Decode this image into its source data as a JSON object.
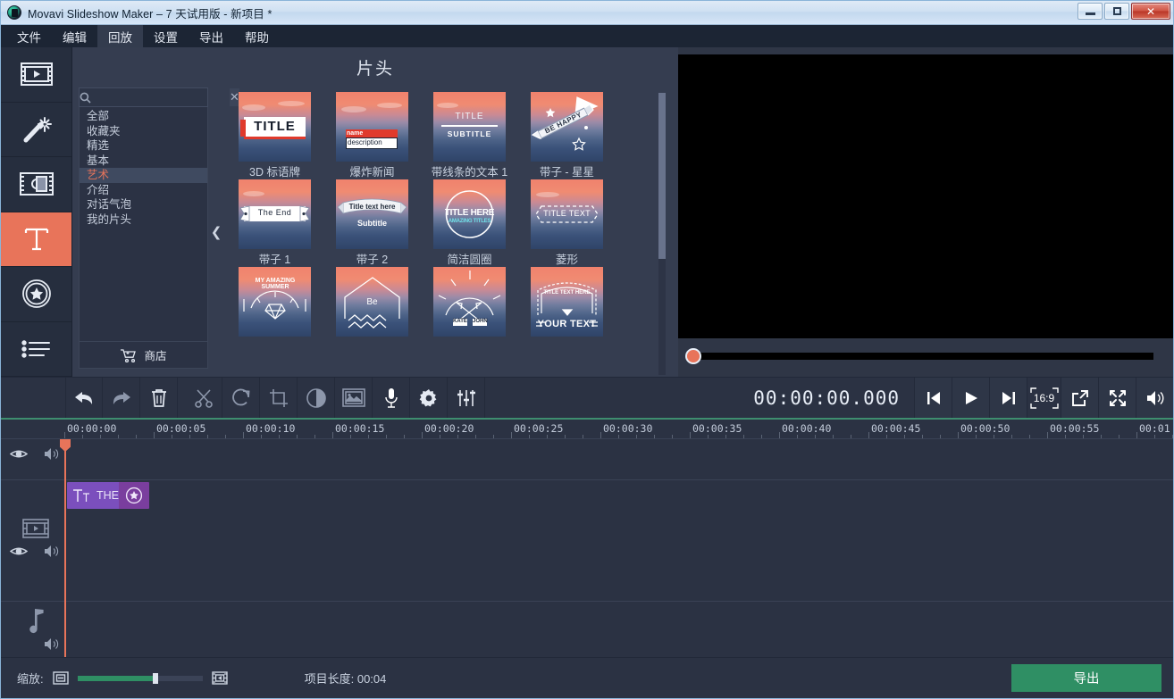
{
  "window": {
    "title": "Movavi Slideshow Maker – 7 天试用版 - 新项目 *",
    "app_icon": "movavi-logo-icon",
    "minimize_label": "",
    "maximize_label": "",
    "close_label": "✕"
  },
  "menubar": {
    "items": [
      {
        "label": "文件",
        "name": "menu-file"
      },
      {
        "label": "编辑",
        "name": "menu-edit"
      },
      {
        "label": "回放",
        "name": "menu-playback",
        "highlighted": true
      },
      {
        "label": "设置",
        "name": "menu-settings"
      },
      {
        "label": "导出",
        "name": "menu-export"
      },
      {
        "label": "帮助",
        "name": "menu-help"
      }
    ]
  },
  "sidebar": {
    "items": [
      {
        "name": "sidebar-item-import",
        "icon": "film-play-icon",
        "active": false
      },
      {
        "name": "sidebar-item-filters",
        "icon": "magic-wand-icon",
        "active": false
      },
      {
        "name": "sidebar-item-transitions",
        "icon": "transition-icon",
        "active": false
      },
      {
        "name": "sidebar-item-titles",
        "icon": "text-t-icon",
        "active": true
      },
      {
        "name": "sidebar-item-stickers",
        "icon": "sticker-star-icon",
        "active": false
      },
      {
        "name": "sidebar-item-more",
        "icon": "list-icon",
        "active": false
      }
    ]
  },
  "library": {
    "header": "片头",
    "search": {
      "value": "",
      "placeholder": "",
      "clear_label": "✕"
    },
    "categories": [
      {
        "label": "全部",
        "selected": false
      },
      {
        "label": "收藏夹",
        "selected": false
      },
      {
        "label": "精选",
        "selected": false
      },
      {
        "label": "基本",
        "selected": false
      },
      {
        "label": "艺术",
        "selected": true
      },
      {
        "label": "介绍",
        "selected": false
      },
      {
        "label": "对话气泡",
        "selected": false
      },
      {
        "label": "我的片头",
        "selected": false
      }
    ],
    "store_label": "商店",
    "collapse_label": "❮",
    "titles": [
      {
        "label": "3D 标语牌",
        "preview_text": "TITLE",
        "style": "board"
      },
      {
        "label": "爆炸新闻",
        "preview_text": "name\ndescription",
        "style": "breaking"
      },
      {
        "label": "带线条的文本 1",
        "preview_text": "TITLE / SUBTITLE",
        "style": "lines"
      },
      {
        "label": "带子 - 星星",
        "preview_text": "BE HAPPY",
        "style": "ribbon-star"
      },
      {
        "label": "带子 1",
        "preview_text": "The End",
        "style": "ribbon1"
      },
      {
        "label": "带子 2",
        "preview_text": "Title text here / Subtitle",
        "style": "ribbon2"
      },
      {
        "label": "简洁圆圈",
        "preview_text": "TITLE HERE / AMAZING TITLES",
        "style": "circle"
      },
      {
        "label": "菱形",
        "preview_text": "TITLE TEXT",
        "style": "diamond"
      },
      {
        "label": "",
        "preview_text": "MY AMAZING SUMMER",
        "style": "summer"
      },
      {
        "label": "",
        "preview_text": "Be",
        "style": "house"
      },
      {
        "label": "",
        "preview_text": "KATE  JOHN",
        "style": "sunburst"
      },
      {
        "label": "",
        "preview_text": "YOUR TEXT",
        "style": "banner"
      }
    ]
  },
  "preview": {
    "seek_position": 0
  },
  "toolbar": {
    "tools": [
      {
        "name": "undo-button",
        "icon": "undo-arrow-icon"
      },
      {
        "name": "redo-button",
        "icon": "redo-arrow-icon"
      },
      {
        "name": "delete-button",
        "icon": "trash-icon"
      },
      {
        "name": "split-button",
        "icon": "scissors-icon"
      },
      {
        "name": "rotate-button",
        "icon": "rotate-icon"
      },
      {
        "name": "crop-button",
        "icon": "crop-icon"
      },
      {
        "name": "color-adjust-button",
        "icon": "contrast-circle-icon"
      },
      {
        "name": "pan-zoom-button",
        "icon": "image-icon"
      },
      {
        "name": "record-audio-button",
        "icon": "microphone-icon"
      },
      {
        "name": "clip-properties-button",
        "icon": "gear-icon"
      },
      {
        "name": "audio-equalizer-button",
        "icon": "sliders-icon"
      }
    ],
    "timecode": "00:00:00.000",
    "player": [
      {
        "name": "prev-frame-button",
        "icon": "skip-previous-icon"
      },
      {
        "name": "play-button",
        "icon": "play-icon"
      },
      {
        "name": "next-frame-button",
        "icon": "skip-next-icon"
      }
    ],
    "aspect_ratio": "16:9",
    "detach_label": "",
    "fullscreen_label": "",
    "volume_label": ""
  },
  "timeline": {
    "ruler_labels": [
      "00:00:00",
      "00:00:05",
      "00:00:10",
      "00:00:15",
      "00:00:20",
      "00:00:25",
      "00:00:30",
      "00:00:35",
      "00:00:40",
      "00:00:45",
      "00:00:50",
      "00:00:55",
      "00:01"
    ],
    "playhead_time": "00:00:00",
    "tracks": [
      {
        "name": "title-track",
        "icon": "",
        "eye": "visible",
        "speaker": "audible"
      },
      {
        "name": "video-track",
        "icon": "film-play-icon",
        "eye": "visible",
        "speaker": "audible"
      },
      {
        "name": "audio-track",
        "icon": "music-note-icon",
        "eye": "",
        "speaker": "audible"
      }
    ],
    "clip": {
      "text": "THE",
      "icon": "title-tt-icon",
      "badge_icon": "sticker-star-icon"
    }
  },
  "bottombar": {
    "zoom_label": "缩放:",
    "zoom_out_icon": "zoom-out-frame-icon",
    "zoom_in_icon": "zoom-in-frame-icon",
    "zoom_percent": 61,
    "project_length_label": "项目长度: 00:04",
    "export_label": "导出"
  }
}
